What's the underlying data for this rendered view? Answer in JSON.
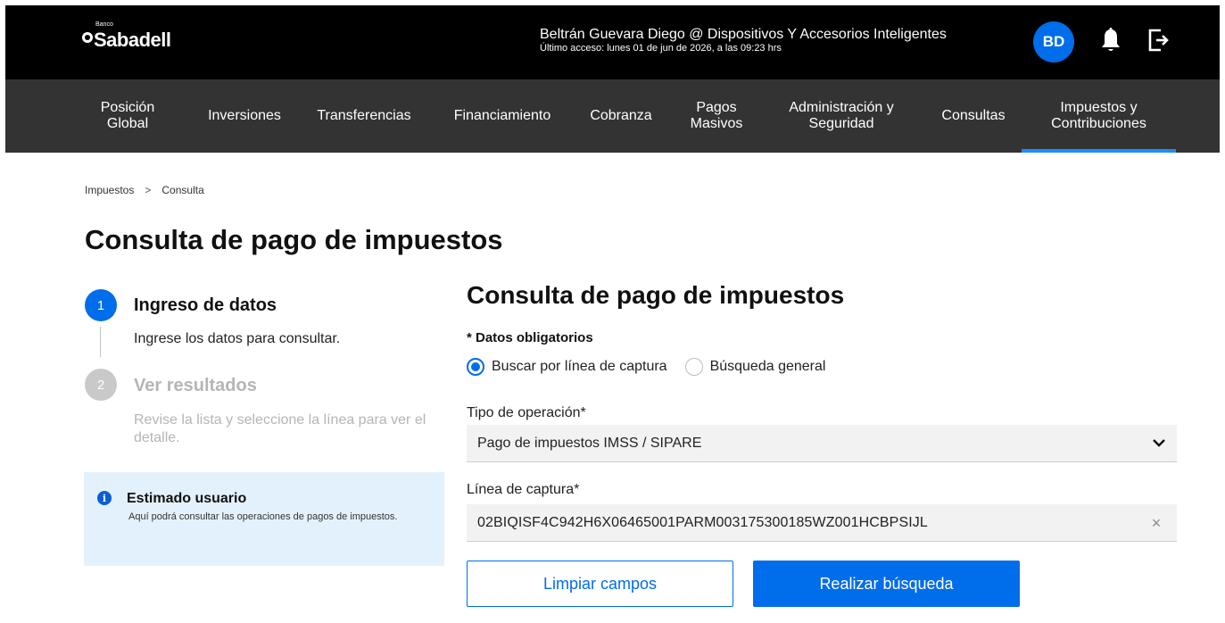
{
  "header": {
    "logo_small": "Banco",
    "logo_text": "Sabadell",
    "user_name": "Beltrán Guevara Diego @ Dispositivos Y Accesorios Inteligentes",
    "last_access": "Último acceso: lunes 01 de jun de 2026, a las 09:23 hrs",
    "avatar_initials": "BD",
    "icons": {
      "notifications": "bell-icon",
      "logout": "logout-icon"
    }
  },
  "nav": {
    "items": [
      {
        "label": "Posición Global",
        "active": false
      },
      {
        "label": "Inversiones",
        "active": false
      },
      {
        "label": "Transferencias",
        "active": false
      },
      {
        "label": "Financiamiento",
        "active": false
      },
      {
        "label": "Cobranza",
        "active": false
      },
      {
        "label": "Pagos Masivos",
        "active": false
      },
      {
        "label": "Administración y Seguridad",
        "active": false
      },
      {
        "label": "Consultas",
        "active": false
      },
      {
        "label": "Impuestos y Contribuciones",
        "active": true
      }
    ]
  },
  "breadcrumb": {
    "items": [
      "Impuestos",
      "Consulta"
    ],
    "separator": ">"
  },
  "page": {
    "title": "Consulta de pago de impuestos"
  },
  "steps": [
    {
      "number": "1",
      "title": "Ingreso de datos",
      "description": "Ingrese los datos para consultar.",
      "active": true
    },
    {
      "number": "2",
      "title": "Ver resultados",
      "description": "Revise la lista y seleccione la línea para ver el detalle.",
      "active": false
    }
  ],
  "info": {
    "title": "Estimado usuario",
    "text": "Aquí podrá consultar las operaciones de pagos de impuestos.",
    "icon": "info-icon"
  },
  "form": {
    "title": "Consulta de pago de impuestos",
    "required_note": "* Datos obligatorios",
    "search_modes": [
      {
        "label": "Buscar por línea de captura",
        "selected": true
      },
      {
        "label": "Búsqueda general",
        "selected": false
      }
    ],
    "operation_type": {
      "label": "Tipo de operación*",
      "value": "Pago de impuestos IMSS / SIPARE"
    },
    "capture_line": {
      "label": "Línea de captura*",
      "value": "02BIQISF4C942H6X06465001PARM003175300185WZ001HCBPSIJL"
    },
    "buttons": {
      "clear": "Limpiar campos",
      "search": "Realizar búsqueda"
    }
  },
  "colors": {
    "primary": "#006dea",
    "topbar": "#000000",
    "navbar": "#333333",
    "nav_active_underline": "#1e8cff",
    "info_bg": "#e3f1fd",
    "field_bg": "#f2f2f2",
    "inactive_step": "#c9c9c9"
  }
}
